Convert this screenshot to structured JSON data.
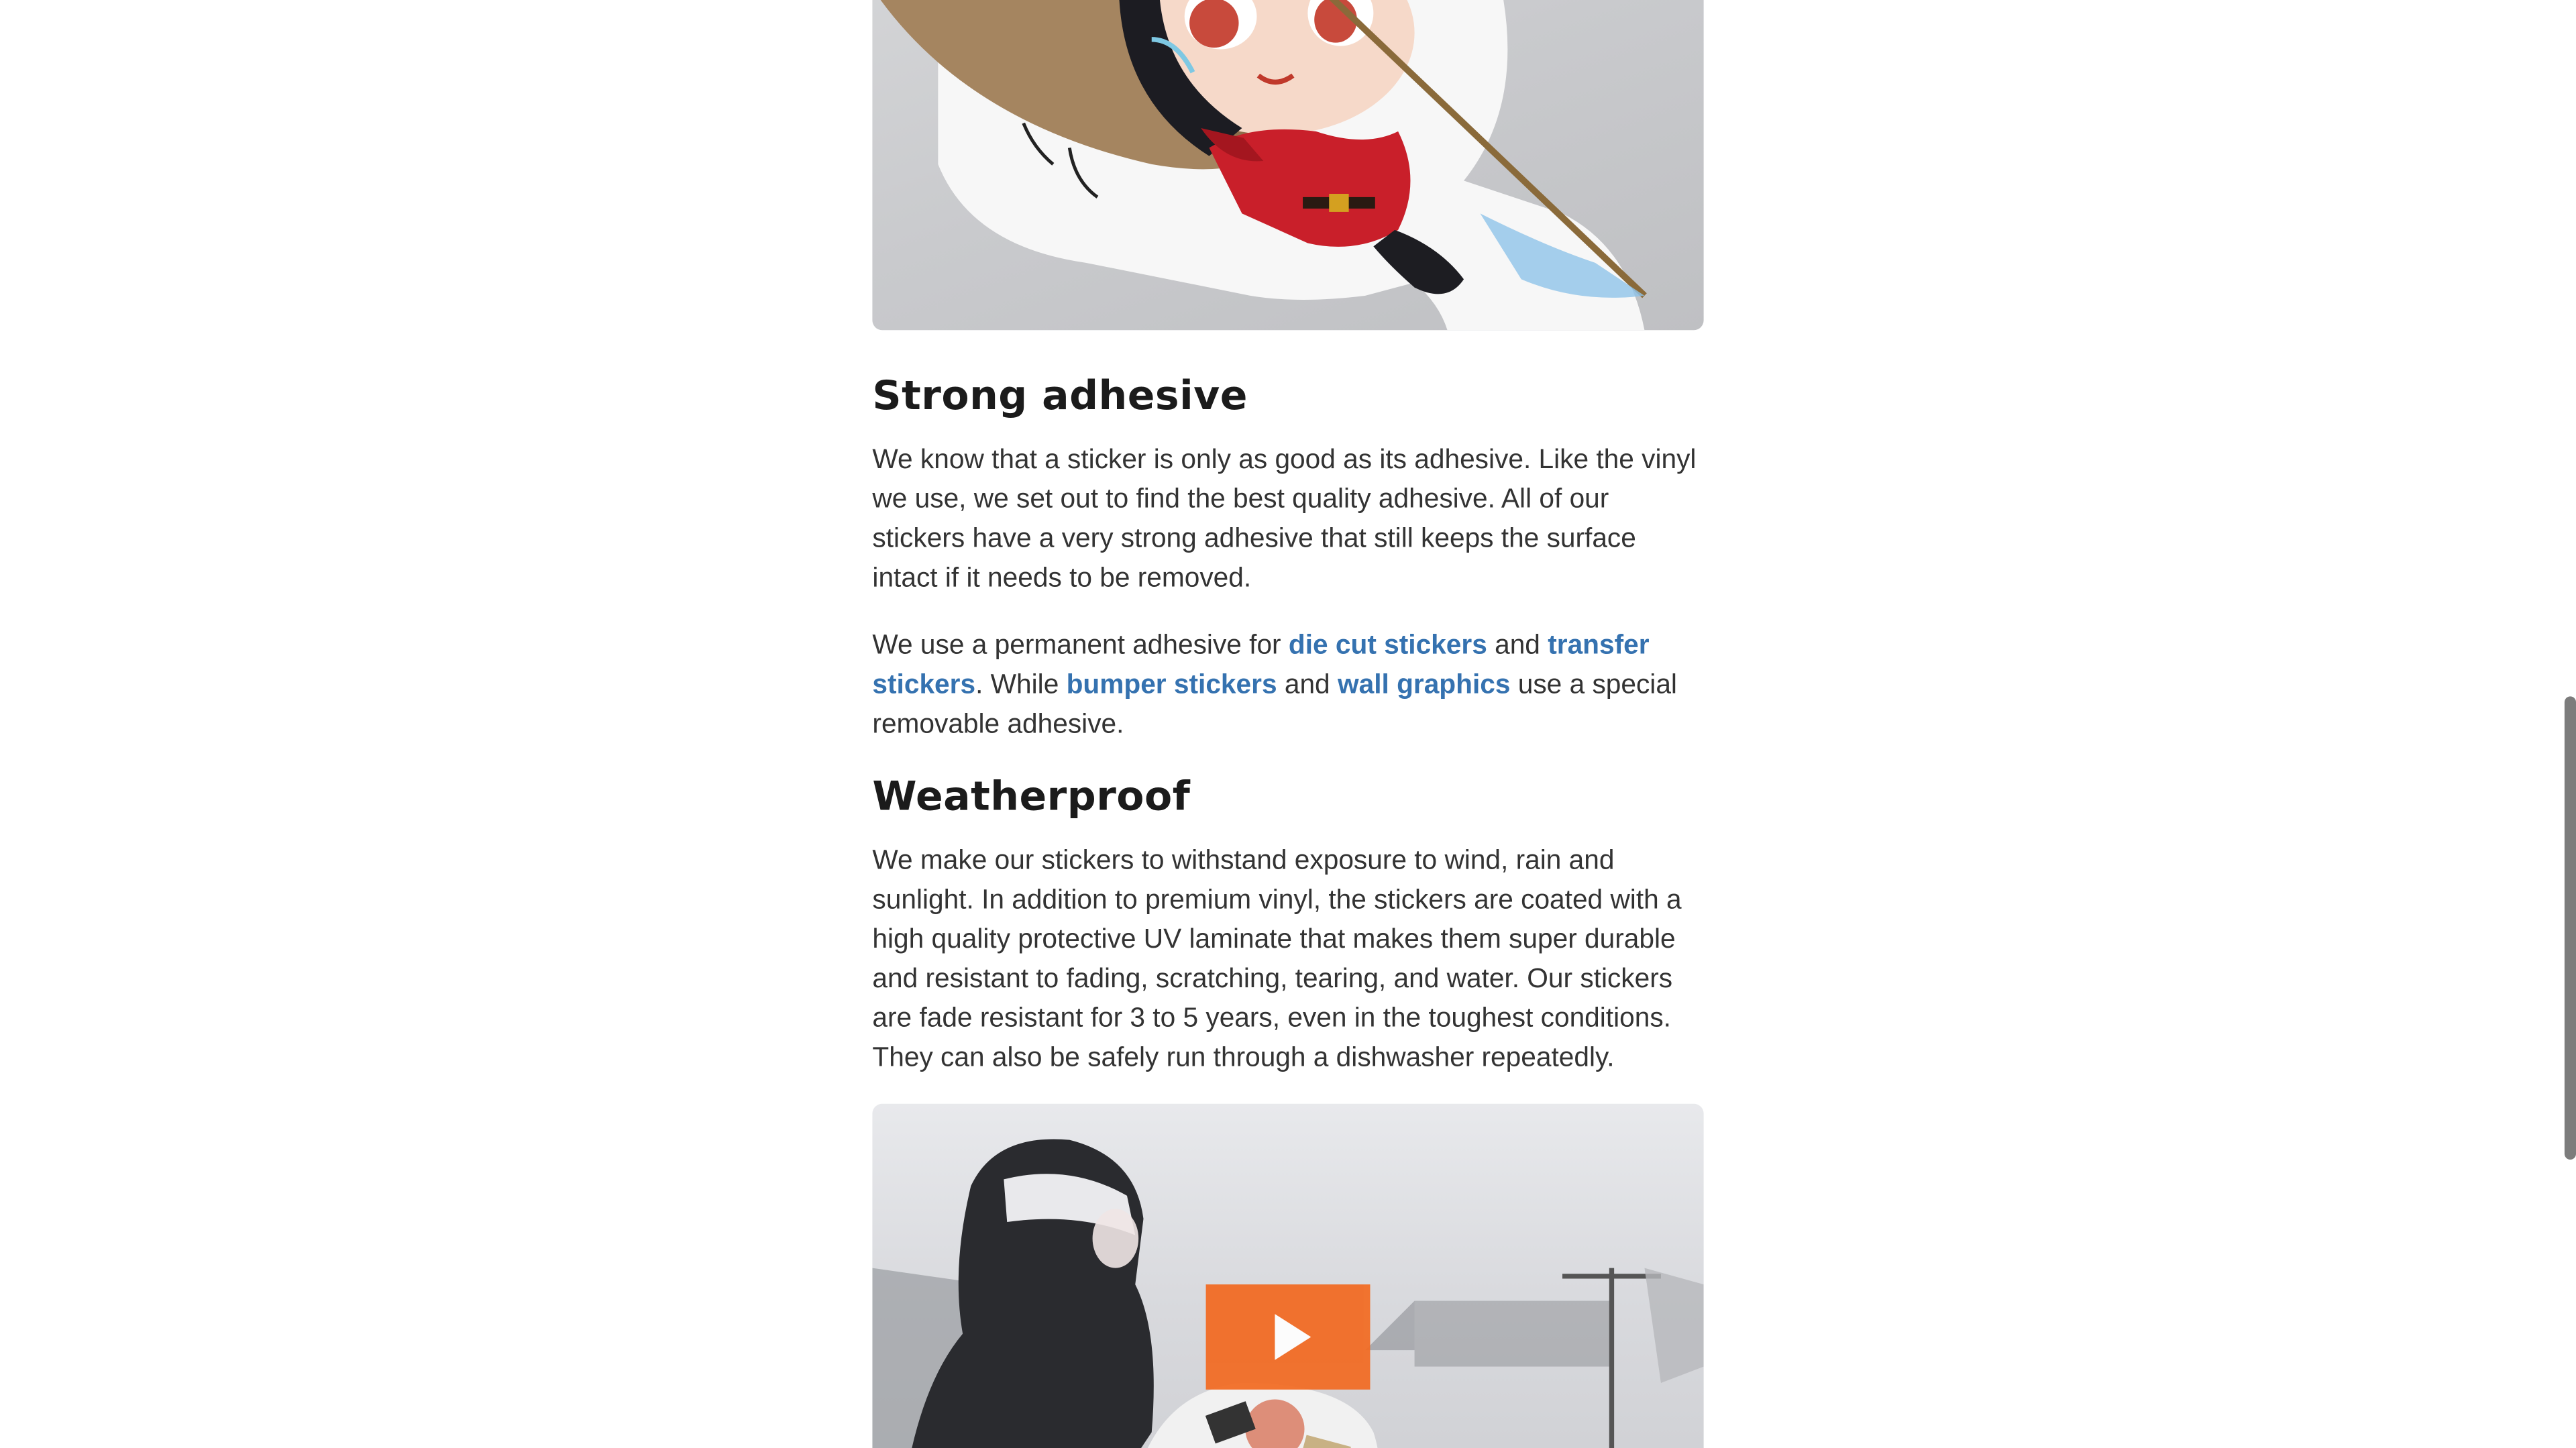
{
  "sections": {
    "strong_adhesive": {
      "heading": "Strong adhesive",
      "paragraph": "We know that a sticker is only as good as its adhesive. Like the vinyl we use, we set out to find the best quality adhesive. All of our stickers have a very strong adhesive that still keeps the surface intact if it needs to be removed.",
      "p2_text1": "We use a permanent adhesive for ",
      "link_die_cut": "die cut stickers",
      "p2_text2": " and ",
      "link_transfer": "transfer stickers",
      "p2_text3": ". While ",
      "link_bumper": "bumper stickers",
      "p2_text4": " and ",
      "link_wall": "wall graphics",
      "p2_text5": " use a special removable adhesive."
    },
    "weatherproof": {
      "heading": "Weatherproof",
      "paragraph": "We make our stickers to withstand exposure to wind, rain and sunlight. In addition to premium vinyl, the stickers are coated with a high quality protective UV laminate that makes them super durable and resistant to fading, scratching, tearing, and water. Our stickers are fade resistant for 3 to 5 years, even in the toughest conditions. They can also be safely run through a dishwasher repeatedly."
    }
  },
  "media": {
    "hero_image_icon": "mountie-octocat-sticker-image",
    "video_icon": "play-icon"
  },
  "colors": {
    "link": "#3572b0",
    "heading": "#1b1b1b",
    "body_text": "#333333",
    "play_button": "#f26a21"
  }
}
